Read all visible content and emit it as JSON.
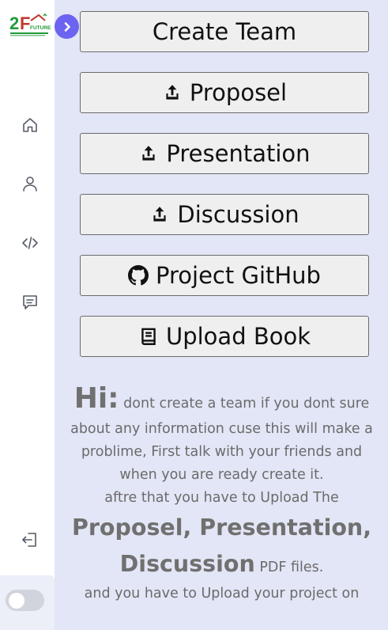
{
  "sidebar": {
    "logo_text": "2Future",
    "nav": [
      {
        "icon": "home-icon"
      },
      {
        "icon": "user-icon"
      },
      {
        "icon": "code-icon"
      },
      {
        "icon": "message-icon"
      }
    ],
    "logout_icon": "logout-icon",
    "theme_toggle": {
      "on": false
    }
  },
  "expand_icon": "chevron-right-icon",
  "actions": [
    {
      "label": "Create Team",
      "icon": null
    },
    {
      "label": "Proposel",
      "icon": "upload-icon"
    },
    {
      "label": "Presentation",
      "icon": "upload-icon"
    },
    {
      "label": "Discussion",
      "icon": "upload-icon"
    },
    {
      "label": "Project GitHub",
      "icon": "github-icon"
    },
    {
      "label": "Upload Book",
      "icon": "book-icon"
    }
  ],
  "note": {
    "hi": "Hi:",
    "line1": "dont create a team if you dont sure about any information cuse this will make a problime, First talk with your friends and when you are ready create it.",
    "line2": "aftre that you have to Upload The",
    "emphasis1": "Proposel, Presentation,",
    "emphasis2": "Discussion",
    "files": "PDF files.",
    "line3": "and you have to Upload your project on"
  }
}
